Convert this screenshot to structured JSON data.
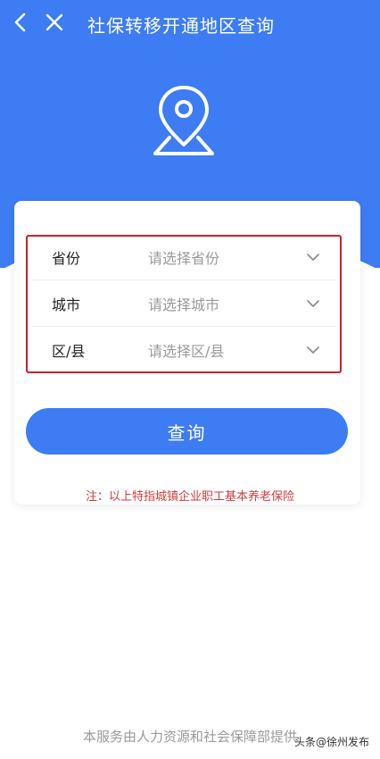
{
  "nav": {
    "title": "社保转移开通地区查询",
    "back_icon": "chevron-left-icon",
    "close_icon": "close-icon"
  },
  "header": {
    "icon": "location-pin-icon",
    "color": "#3d7cf2"
  },
  "form": {
    "fields": [
      {
        "label": "省份",
        "placeholder": "请选择省份"
      },
      {
        "label": "城市",
        "placeholder": "请选择城市"
      },
      {
        "label": "区/县",
        "placeholder": "请选择区/县"
      }
    ],
    "highlight_color": "#c8232c"
  },
  "query_button": {
    "label": "查询"
  },
  "note": "注：以上特指城镇企业职工基本养老保险",
  "footer": "本服务由人力资源和社会保障部提供",
  "watermark": "头条@徐州发布"
}
